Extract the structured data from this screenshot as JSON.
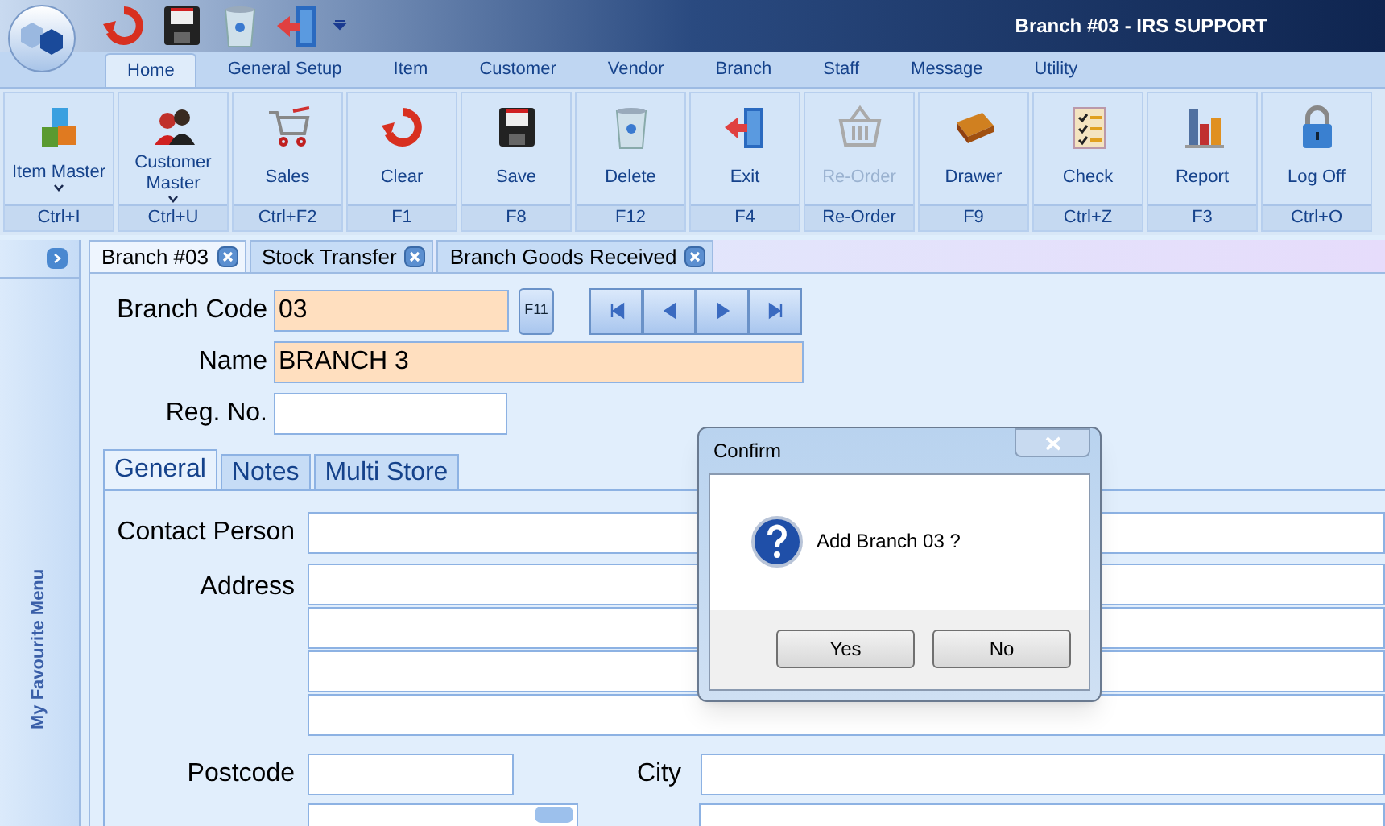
{
  "window": {
    "title": "Branch #03 - IRS SUPPORT"
  },
  "ribbon_tabs": [
    {
      "label": "Home",
      "selected": true
    },
    {
      "label": "General Setup",
      "selected": false
    },
    {
      "label": "Item",
      "selected": false
    },
    {
      "label": "Customer",
      "selected": false
    },
    {
      "label": "Vendor",
      "selected": false
    },
    {
      "label": "Branch",
      "selected": false
    },
    {
      "label": "Staff",
      "selected": false
    },
    {
      "label": "Message",
      "selected": false
    },
    {
      "label": "Utility",
      "selected": false
    }
  ],
  "ribbon_buttons": [
    {
      "label": "Item Master",
      "dropdown": true,
      "disabled": false,
      "shortcut": "Ctrl+I"
    },
    {
      "label": "Customer Master",
      "dropdown": true,
      "disabled": false,
      "shortcut": "Ctrl+U"
    },
    {
      "label": "Sales",
      "dropdown": false,
      "disabled": false,
      "shortcut": "Ctrl+F2"
    },
    {
      "label": "Clear",
      "dropdown": false,
      "disabled": false,
      "shortcut": "F1"
    },
    {
      "label": "Save",
      "dropdown": false,
      "disabled": false,
      "shortcut": "F8"
    },
    {
      "label": "Delete",
      "dropdown": false,
      "disabled": false,
      "shortcut": "F12"
    },
    {
      "label": "Exit",
      "dropdown": false,
      "disabled": false,
      "shortcut": "F4"
    },
    {
      "label": "Re-Order",
      "dropdown": false,
      "disabled": true,
      "shortcut": "Re-Order"
    },
    {
      "label": "Drawer",
      "dropdown": false,
      "disabled": false,
      "shortcut": "F9"
    },
    {
      "label": "Check",
      "dropdown": false,
      "disabled": false,
      "shortcut": "Ctrl+Z"
    },
    {
      "label": "Report",
      "dropdown": false,
      "disabled": false,
      "shortcut": "F3"
    },
    {
      "label": "Log Off",
      "dropdown": false,
      "disabled": false,
      "shortcut": "Ctrl+O"
    }
  ],
  "sidebar": {
    "label": "My Favourite Menu"
  },
  "document_tabs": [
    {
      "label": "Branch #03",
      "selected": true
    },
    {
      "label": "Stock Transfer",
      "selected": false
    },
    {
      "label": "Branch Goods Received",
      "selected": false
    }
  ],
  "form": {
    "branch_code": {
      "label": "Branch Code",
      "value": "03"
    },
    "lookup_button": "F11",
    "name": {
      "label": "Name",
      "value": "BRANCH 3"
    },
    "reg_no": {
      "label": "Reg. No."
    }
  },
  "inner_tabs": [
    {
      "label": "General",
      "selected": true
    },
    {
      "label": "Notes",
      "selected": false
    },
    {
      "label": "Multi Store",
      "selected": false
    }
  ],
  "general": {
    "contact_person": {
      "label": "Contact Person"
    },
    "address": {
      "label": "Address"
    },
    "postcode": {
      "label": "Postcode"
    },
    "city": {
      "label": "City"
    }
  },
  "dialog": {
    "title": "Confirm",
    "message": "Add Branch 03 ?",
    "buttons": [
      "Yes",
      "No"
    ]
  }
}
